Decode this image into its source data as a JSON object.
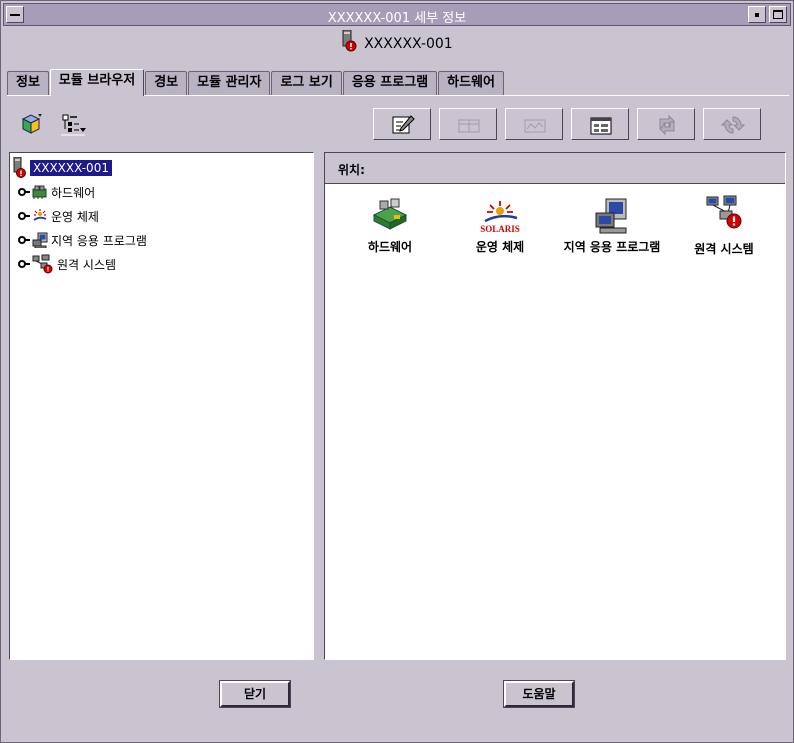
{
  "window": {
    "title": "XXXXXX-001 세부 정보",
    "header_title": "XXXXXX-001"
  },
  "tabs": [
    {
      "label": "정보",
      "active": false
    },
    {
      "label": "모듈 브라우저",
      "active": true
    },
    {
      "label": "경보",
      "active": false
    },
    {
      "label": "모듈 관리자",
      "active": false
    },
    {
      "label": "로그 보기",
      "active": false
    },
    {
      "label": "응용 프로그램",
      "active": false
    },
    {
      "label": "하드웨어",
      "active": false
    }
  ],
  "toolbar": {
    "left": [
      {
        "icon": "hierarchy-view-icon"
      },
      {
        "icon": "list-view-icon"
      }
    ],
    "right": [
      {
        "icon": "edit-icon",
        "enabled": true
      },
      {
        "icon": "table-icon",
        "enabled": false
      },
      {
        "icon": "graph-icon",
        "enabled": false
      },
      {
        "icon": "details-window-icon",
        "enabled": true
      },
      {
        "icon": "refresh-icon",
        "enabled": false
      },
      {
        "icon": "reload-icon",
        "enabled": false
      }
    ]
  },
  "tree": {
    "root": {
      "label": "XXXXXX-001",
      "icon": "host-alarm-icon"
    },
    "children": [
      {
        "label": "하드웨어",
        "icon": "hardware-icon"
      },
      {
        "label": "운영 체제",
        "icon": "solaris-icon"
      },
      {
        "label": "지역 응용 프로그램",
        "icon": "local-apps-icon"
      },
      {
        "label": "원격 시스템",
        "icon": "remote-systems-alarm-icon"
      }
    ]
  },
  "location": {
    "label": "위치:"
  },
  "icons": [
    {
      "label": "하드웨어",
      "icon": "hardware-icon"
    },
    {
      "label": "운영 체제",
      "icon": "solaris-logo-icon",
      "logo_text": "SOLARIS"
    },
    {
      "label": "지역 응용 프로그램",
      "icon": "local-apps-icon"
    },
    {
      "label": "원격 시스템",
      "icon": "remote-systems-alarm-icon"
    }
  ],
  "buttons": {
    "close": "닫기",
    "help": "도움말"
  },
  "colors": {
    "title_bar": "#a89db8",
    "background": "#c9c4d0",
    "selection": "#1f1a8a",
    "alarm": "#d40000"
  }
}
